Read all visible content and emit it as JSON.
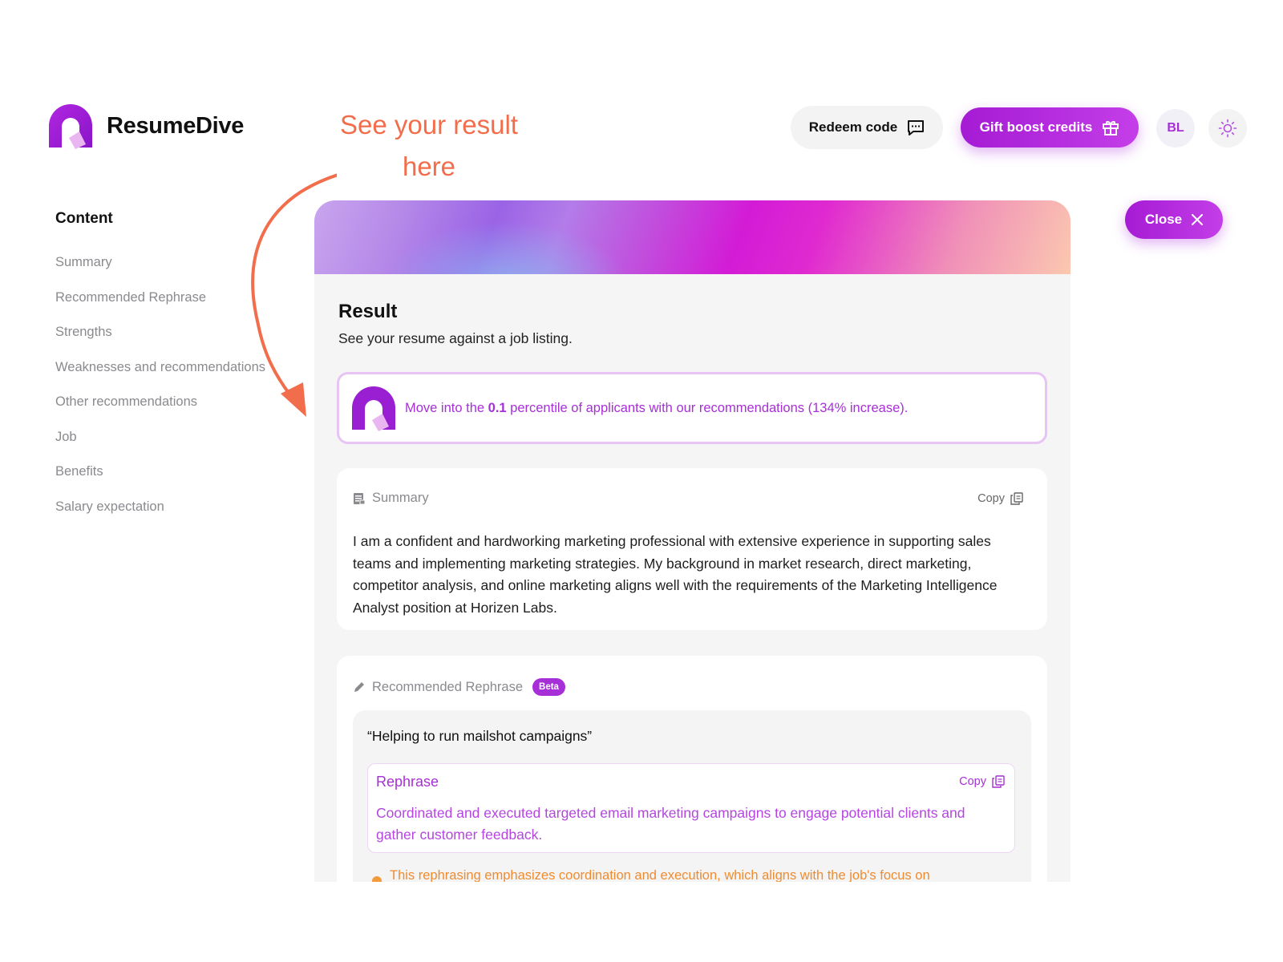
{
  "header": {
    "brand": "ResumeDive",
    "redeem_label": "Redeem code",
    "gift_label": "Gift boost credits",
    "avatar_initials": "BL"
  },
  "annotation": {
    "line1": "See your result",
    "line2": "here",
    "color": "#f26d4b"
  },
  "sidebar": {
    "title": "Content",
    "items": [
      {
        "label": "Summary"
      },
      {
        "label": "Recommended Rephrase"
      },
      {
        "label": "Strengths"
      },
      {
        "label": "Weaknesses and recommendations"
      },
      {
        "label": "Other recommendations"
      },
      {
        "label": "Job"
      },
      {
        "label": "Benefits"
      },
      {
        "label": "Salary expectation"
      }
    ]
  },
  "close_label": "Close",
  "result": {
    "title": "Result",
    "subtitle": "See your resume against a job listing."
  },
  "promo": {
    "prefix": "Move into the ",
    "percentile": "0.1",
    "suffix": " percentile of applicants with our recommendations (134% increase)."
  },
  "summary_card": {
    "heading": "Summary",
    "copy_label": "Copy",
    "text": "I am a confident and hardworking marketing professional with extensive experience in supporting sales teams and implementing marketing strategies. My background in market research, direct marketing, competitor analysis, and online marketing aligns well with the requirements of the Marketing Intelligence Analyst position at Horizen Labs."
  },
  "rephrase_card": {
    "heading": "Recommended Rephrase",
    "badge": "Beta",
    "quote": "“Helping to run mailshot campaigns”",
    "rephrase_label": "Rephrase",
    "copy_label": "Copy",
    "rephrase_text": "Coordinated and executed targeted email marketing campaigns to engage potential clients and gather customer feedback.",
    "note": "This rephrasing emphasizes coordination and execution, which aligns with the job's focus on"
  },
  "colors": {
    "accent": "#a72fd8",
    "note": "#ef8b2f"
  }
}
